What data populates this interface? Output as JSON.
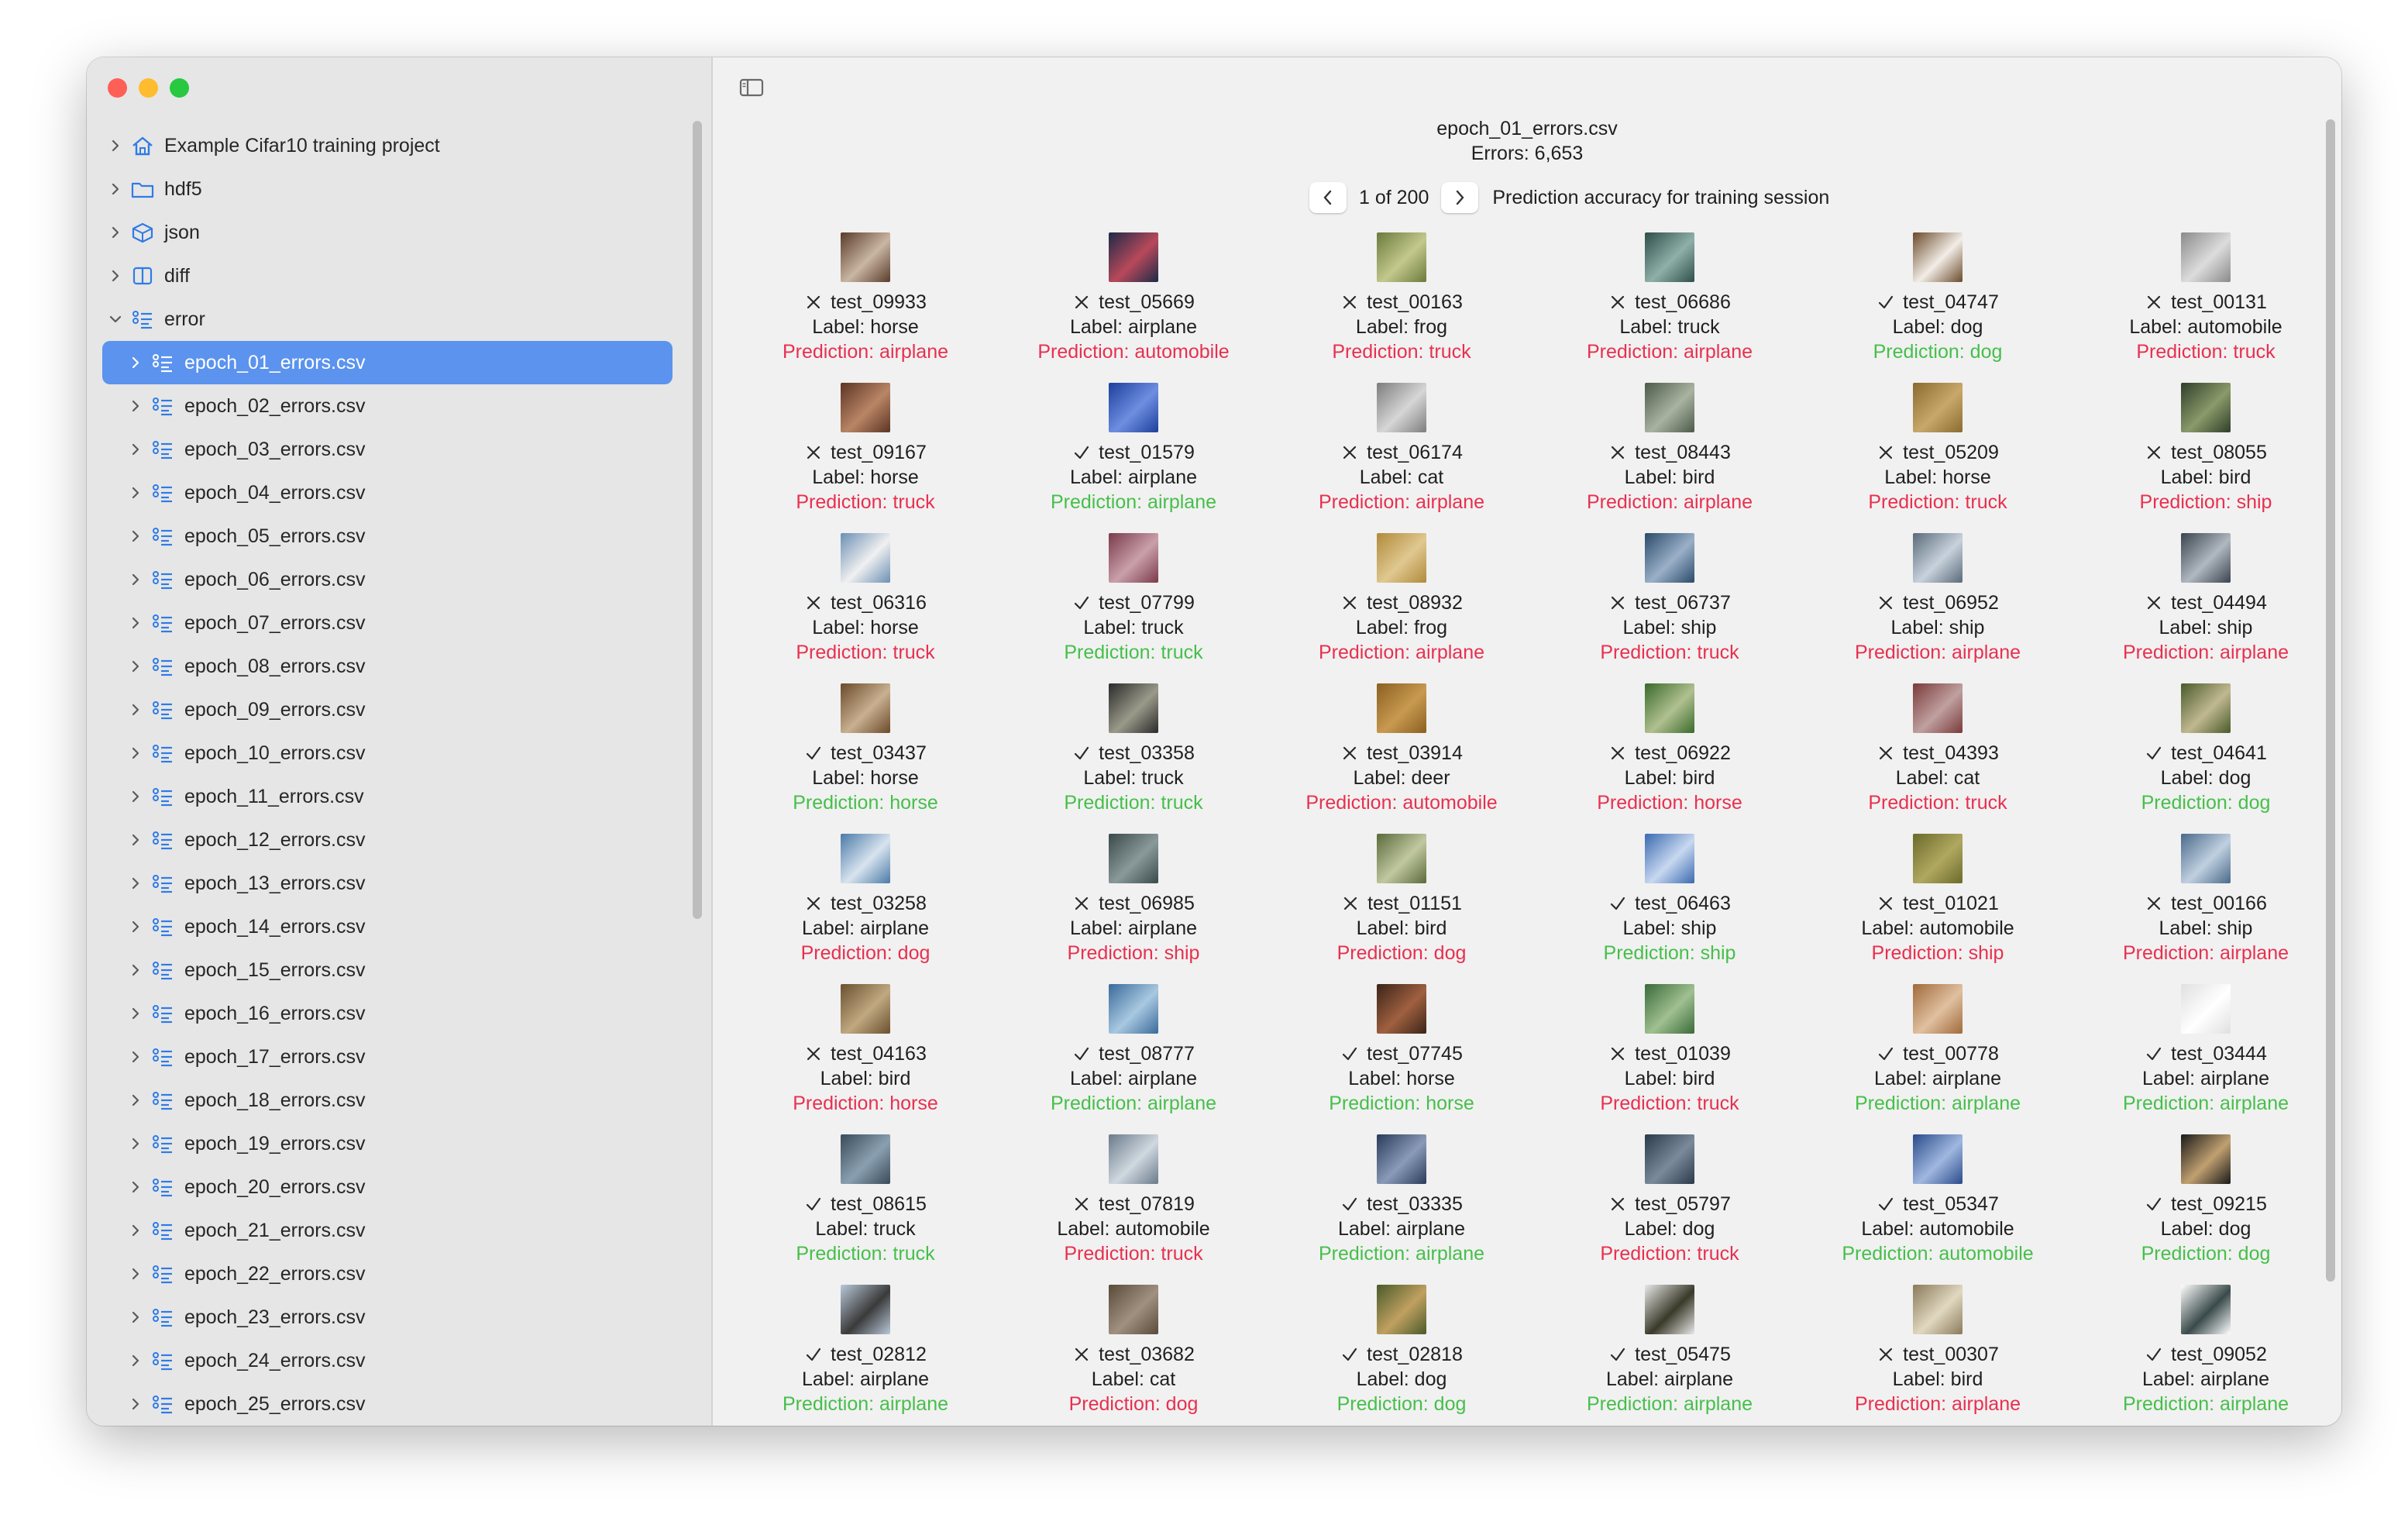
{
  "sidebar": {
    "items": [
      {
        "label": "Example Cifar10 training project",
        "icon": "house-icon",
        "level": 1,
        "expanded": false
      },
      {
        "label": "hdf5",
        "icon": "folder-icon",
        "level": 1,
        "expanded": false
      },
      {
        "label": "json",
        "icon": "cube-icon",
        "level": 1,
        "expanded": false
      },
      {
        "label": "diff",
        "icon": "split-columns-icon",
        "level": 1,
        "expanded": false
      },
      {
        "label": "error",
        "icon": "list-icon",
        "level": 1,
        "expanded": true
      }
    ],
    "error_files": [
      "epoch_01_errors.csv",
      "epoch_02_errors.csv",
      "epoch_03_errors.csv",
      "epoch_04_errors.csv",
      "epoch_05_errors.csv",
      "epoch_06_errors.csv",
      "epoch_07_errors.csv",
      "epoch_08_errors.csv",
      "epoch_09_errors.csv",
      "epoch_10_errors.csv",
      "epoch_11_errors.csv",
      "epoch_12_errors.csv",
      "epoch_13_errors.csv",
      "epoch_14_errors.csv",
      "epoch_15_errors.csv",
      "epoch_16_errors.csv",
      "epoch_17_errors.csv",
      "epoch_18_errors.csv",
      "epoch_19_errors.csv",
      "epoch_20_errors.csv",
      "epoch_21_errors.csv",
      "epoch_22_errors.csv",
      "epoch_23_errors.csv",
      "epoch_24_errors.csv",
      "epoch_25_errors.csv"
    ],
    "selected_index": 0
  },
  "header": {
    "title": "epoch_01_errors.csv",
    "errors_text": "Errors:  6,653"
  },
  "pager": {
    "page_text": "1 of 200",
    "title": "Prediction accuracy for training session"
  },
  "colors": {
    "selection": "#5b93ee",
    "wrong": "#e8304f",
    "right": "#46bf4a"
  },
  "samples": [
    {
      "id": "test_09933",
      "label": "Label: horse",
      "prediction": "Prediction: airplane",
      "correct": false,
      "thumb": [
        "#5a3b2a",
        "#c9b6a3"
      ]
    },
    {
      "id": "test_05669",
      "label": "Label: airplane",
      "prediction": "Prediction: automobile",
      "correct": false,
      "thumb": [
        "#1d2a48",
        "#b8495a"
      ]
    },
    {
      "id": "test_00163",
      "label": "Label: frog",
      "prediction": "Prediction: truck",
      "correct": false,
      "thumb": [
        "#6b7a3c",
        "#c3c88c"
      ]
    },
    {
      "id": "test_06686",
      "label": "Label: truck",
      "prediction": "Prediction: airplane",
      "correct": false,
      "thumb": [
        "#2e4e4a",
        "#8fb0a8"
      ]
    },
    {
      "id": "test_04747",
      "label": "Label: dog",
      "prediction": "Prediction: dog",
      "correct": true,
      "thumb": [
        "#6b4a2a",
        "#f2ede6"
      ]
    },
    {
      "id": "test_00131",
      "label": "Label: automobile",
      "prediction": "Prediction: truck",
      "correct": false,
      "thumb": [
        "#8a8a8a",
        "#dcdcdc"
      ]
    },
    {
      "id": "test_09167",
      "label": "Label: horse",
      "prediction": "Prediction: truck",
      "correct": false,
      "thumb": [
        "#5c3424",
        "#b98565"
      ]
    },
    {
      "id": "test_01579",
      "label": "Label: airplane",
      "prediction": "Prediction: airplane",
      "correct": true,
      "thumb": [
        "#1d3f9c",
        "#6d8ee0"
      ]
    },
    {
      "id": "test_06174",
      "label": "Label: cat",
      "prediction": "Prediction: airplane",
      "correct": false,
      "thumb": [
        "#7d7d7d",
        "#d6d6d6"
      ]
    },
    {
      "id": "test_08443",
      "label": "Label: bird",
      "prediction": "Prediction: airplane",
      "correct": false,
      "thumb": [
        "#4d5a4a",
        "#a9b3a0"
      ]
    },
    {
      "id": "test_05209",
      "label": "Label: horse",
      "prediction": "Prediction: truck",
      "correct": false,
      "thumb": [
        "#8a6a30",
        "#c9a86a"
      ]
    },
    {
      "id": "test_08055",
      "label": "Label: bird",
      "prediction": "Prediction: ship",
      "correct": false,
      "thumb": [
        "#2f3f2a",
        "#8a9a6a"
      ]
    },
    {
      "id": "test_06316",
      "label": "Label: horse",
      "prediction": "Prediction: truck",
      "correct": false,
      "thumb": [
        "#6c8fb4",
        "#f0f0f0"
      ]
    },
    {
      "id": "test_07799",
      "label": "Label: truck",
      "prediction": "Prediction: truck",
      "correct": true,
      "thumb": [
        "#7a3a4a",
        "#c9a0aa"
      ]
    },
    {
      "id": "test_08932",
      "label": "Label: frog",
      "prediction": "Prediction: airplane",
      "correct": false,
      "thumb": [
        "#b08a3a",
        "#e0c890"
      ]
    },
    {
      "id": "test_06737",
      "label": "Label: ship",
      "prediction": "Prediction: truck",
      "correct": false,
      "thumb": [
        "#2a4a6a",
        "#9ab0c8"
      ]
    },
    {
      "id": "test_06952",
      "label": "Label: ship",
      "prediction": "Prediction: airplane",
      "correct": false,
      "thumb": [
        "#5a6a7a",
        "#c8d2dc"
      ]
    },
    {
      "id": "test_04494",
      "label": "Label: ship",
      "prediction": "Prediction: airplane",
      "correct": false,
      "thumb": [
        "#3a4450",
        "#b0b8c0"
      ]
    },
    {
      "id": "test_03437",
      "label": "Label: horse",
      "prediction": "Prediction: horse",
      "correct": true,
      "thumb": [
        "#6a4a2a",
        "#c8b090"
      ]
    },
    {
      "id": "test_03358",
      "label": "Label: truck",
      "prediction": "Prediction: truck",
      "correct": true,
      "thumb": [
        "#2a2a2a",
        "#9a9a8a"
      ]
    },
    {
      "id": "test_03914",
      "label": "Label: deer",
      "prediction": "Prediction: automobile",
      "correct": false,
      "thumb": [
        "#8a6020",
        "#c89a50"
      ]
    },
    {
      "id": "test_06922",
      "label": "Label: bird",
      "prediction": "Prediction: horse",
      "correct": false,
      "thumb": [
        "#3a6a2a",
        "#b0c090"
      ]
    },
    {
      "id": "test_04393",
      "label": "Label: cat",
      "prediction": "Prediction: truck",
      "correct": false,
      "thumb": [
        "#7a3a3a",
        "#c0a0a0"
      ]
    },
    {
      "id": "test_04641",
      "label": "Label: dog",
      "prediction": "Prediction: dog",
      "correct": true,
      "thumb": [
        "#4a5a2a",
        "#c0b890"
      ]
    },
    {
      "id": "test_03258",
      "label": "Label: airplane",
      "prediction": "Prediction: dog",
      "correct": false,
      "thumb": [
        "#4a7aa8",
        "#d8e4ee"
      ]
    },
    {
      "id": "test_06985",
      "label": "Label: airplane",
      "prediction": "Prediction: ship",
      "correct": false,
      "thumb": [
        "#3a4a4a",
        "#8a9a9a"
      ]
    },
    {
      "id": "test_01151",
      "label": "Label: bird",
      "prediction": "Prediction: dog",
      "correct": false,
      "thumb": [
        "#5a6a3a",
        "#c0c8a0"
      ]
    },
    {
      "id": "test_06463",
      "label": "Label: ship",
      "prediction": "Prediction: ship",
      "correct": true,
      "thumb": [
        "#3a6ab0",
        "#c8d8f0"
      ]
    },
    {
      "id": "test_01021",
      "label": "Label: automobile",
      "prediction": "Prediction: ship",
      "correct": false,
      "thumb": [
        "#6a6a2a",
        "#b0a860"
      ]
    },
    {
      "id": "test_00166",
      "label": "Label: ship",
      "prediction": "Prediction: airplane",
      "correct": false,
      "thumb": [
        "#4a6a8a",
        "#c0d0e0"
      ]
    },
    {
      "id": "test_04163",
      "label": "Label: bird",
      "prediction": "Prediction: horse",
      "correct": false,
      "thumb": [
        "#6a5030",
        "#c0a880"
      ]
    },
    {
      "id": "test_08777",
      "label": "Label: airplane",
      "prediction": "Prediction: airplane",
      "correct": true,
      "thumb": [
        "#3a6a9a",
        "#a8c8e0"
      ]
    },
    {
      "id": "test_07745",
      "label": "Label: horse",
      "prediction": "Prediction: horse",
      "correct": true,
      "thumb": [
        "#3a2418",
        "#a06040"
      ]
    },
    {
      "id": "test_01039",
      "label": "Label: bird",
      "prediction": "Prediction: truck",
      "correct": false,
      "thumb": [
        "#3a6a3a",
        "#a0c090"
      ]
    },
    {
      "id": "test_00778",
      "label": "Label: airplane",
      "prediction": "Prediction: airplane",
      "correct": true,
      "thumb": [
        "#a06a3a",
        "#e0c0a0"
      ]
    },
    {
      "id": "test_03444",
      "label": "Label: airplane",
      "prediction": "Prediction: airplane",
      "correct": true,
      "thumb": [
        "#e0e0e0",
        "#ffffff"
      ]
    },
    {
      "id": "test_08615",
      "label": "Label: truck",
      "prediction": "Prediction: truck",
      "correct": true,
      "thumb": [
        "#3a4a5a",
        "#8aa0b0"
      ]
    },
    {
      "id": "test_07819",
      "label": "Label: automobile",
      "prediction": "Prediction: truck",
      "correct": false,
      "thumb": [
        "#6a7a8a",
        "#d0d8e0"
      ]
    },
    {
      "id": "test_03335",
      "label": "Label: airplane",
      "prediction": "Prediction: airplane",
      "correct": true,
      "thumb": [
        "#2a3a5a",
        "#8a9ab8"
      ]
    },
    {
      "id": "test_05797",
      "label": "Label: dog",
      "prediction": "Prediction: truck",
      "correct": false,
      "thumb": [
        "#2a3a4a",
        "#7a8a9a"
      ]
    },
    {
      "id": "test_05347",
      "label": "Label: automobile",
      "prediction": "Prediction: automobile",
      "correct": true,
      "thumb": [
        "#2a4a8a",
        "#a0b8e0"
      ]
    },
    {
      "id": "test_09215",
      "label": "Label: dog",
      "prediction": "Prediction: dog",
      "correct": true,
      "thumb": [
        "#1a1a1a",
        "#c0a070"
      ]
    },
    {
      "id": "test_02812",
      "label": "Label: airplane",
      "prediction": "Prediction: airplane",
      "correct": true,
      "thumb": [
        "#b8c8d8",
        "#3a3a3a"
      ]
    },
    {
      "id": "test_03682",
      "label": "Label: cat",
      "prediction": "Prediction: dog",
      "correct": false,
      "thumb": [
        "#5a4a3a",
        "#a09080"
      ]
    },
    {
      "id": "test_02818",
      "label": "Label: dog",
      "prediction": "Prediction: dog",
      "correct": true,
      "thumb": [
        "#4a5a2a",
        "#c0a060"
      ]
    },
    {
      "id": "test_05475",
      "label": "Label: airplane",
      "prediction": "Prediction: airplane",
      "correct": true,
      "thumb": [
        "#e8e8e8",
        "#3a3a2a"
      ]
    },
    {
      "id": "test_00307",
      "label": "Label: bird",
      "prediction": "Prediction: airplane",
      "correct": false,
      "thumb": [
        "#8a7a5a",
        "#e0d8c0"
      ]
    },
    {
      "id": "test_09052",
      "label": "Label: airplane",
      "prediction": "Prediction: airplane",
      "correct": true,
      "thumb": [
        "#ffffff",
        "#3a4a4a"
      ]
    }
  ]
}
